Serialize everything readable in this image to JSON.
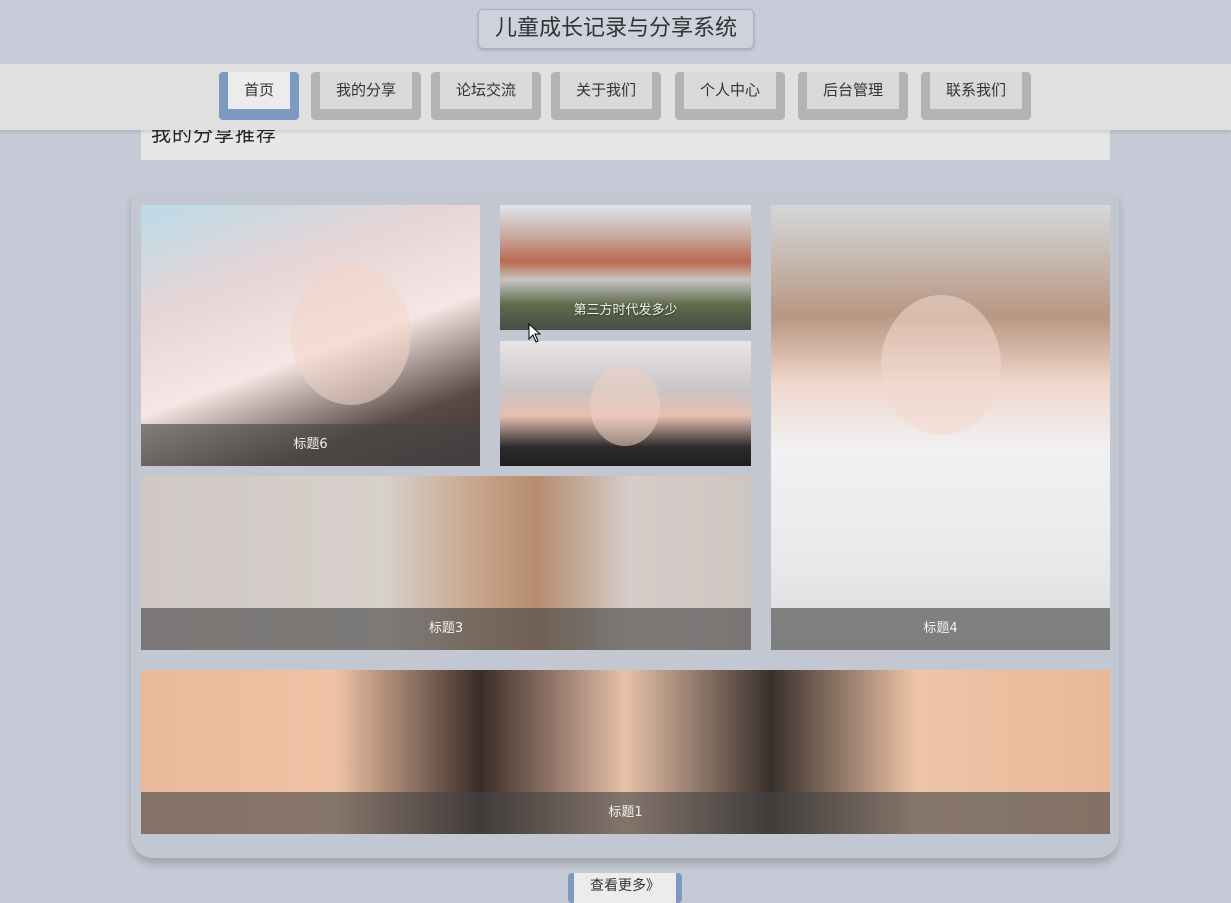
{
  "header": {
    "title": "儿童成长记录与分享系统"
  },
  "nav": {
    "items": [
      {
        "label": "首页",
        "active": true
      },
      {
        "label": "我的分享",
        "active": false
      },
      {
        "label": "论坛交流",
        "active": false
      },
      {
        "label": "关于我们",
        "active": false
      },
      {
        "label": "个人中心",
        "active": false
      },
      {
        "label": "后台管理",
        "active": false
      },
      {
        "label": "联系我们",
        "active": false
      }
    ]
  },
  "section": {
    "title": "我的分享推荐"
  },
  "gallery": {
    "tiles": [
      {
        "caption": "标题6"
      },
      {
        "caption": "第三方时代发多少"
      },
      {
        "caption": ""
      },
      {
        "caption": "标题4"
      },
      {
        "caption": "标题3"
      },
      {
        "caption": "标题1"
      }
    ]
  },
  "more": {
    "label": "查看更多》"
  },
  "colors": {
    "accent": "#7d98c1",
    "background": "#c5cad6",
    "nav_bg": "#e0e0e0"
  }
}
